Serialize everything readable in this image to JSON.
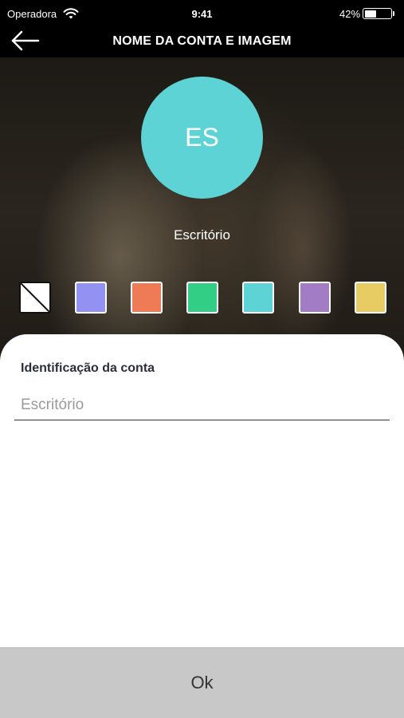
{
  "status_bar": {
    "carrier": "Operadora",
    "time": "9:41",
    "battery_percent": "42%",
    "battery_level": 0.42
  },
  "nav": {
    "title": "NOME DA CONTA E IMAGEM",
    "back_icon": "arrow-left-icon"
  },
  "avatar": {
    "initials": "ES",
    "color": "#5ED3D6"
  },
  "account_name": "Escritório",
  "swatches": [
    {
      "name": "none",
      "color": "#FFFFFF"
    },
    {
      "name": "blue",
      "color": "#9391F2"
    },
    {
      "name": "orange",
      "color": "#EE7B56"
    },
    {
      "name": "green",
      "color": "#33CE86"
    },
    {
      "name": "cyan",
      "color": "#5ED3D6"
    },
    {
      "name": "purple",
      "color": "#A27DC5"
    },
    {
      "name": "yellow",
      "color": "#E6CC62"
    }
  ],
  "form": {
    "label": "Identificação da conta",
    "placeholder": "Escritório",
    "value": ""
  },
  "ok_label": "Ok"
}
